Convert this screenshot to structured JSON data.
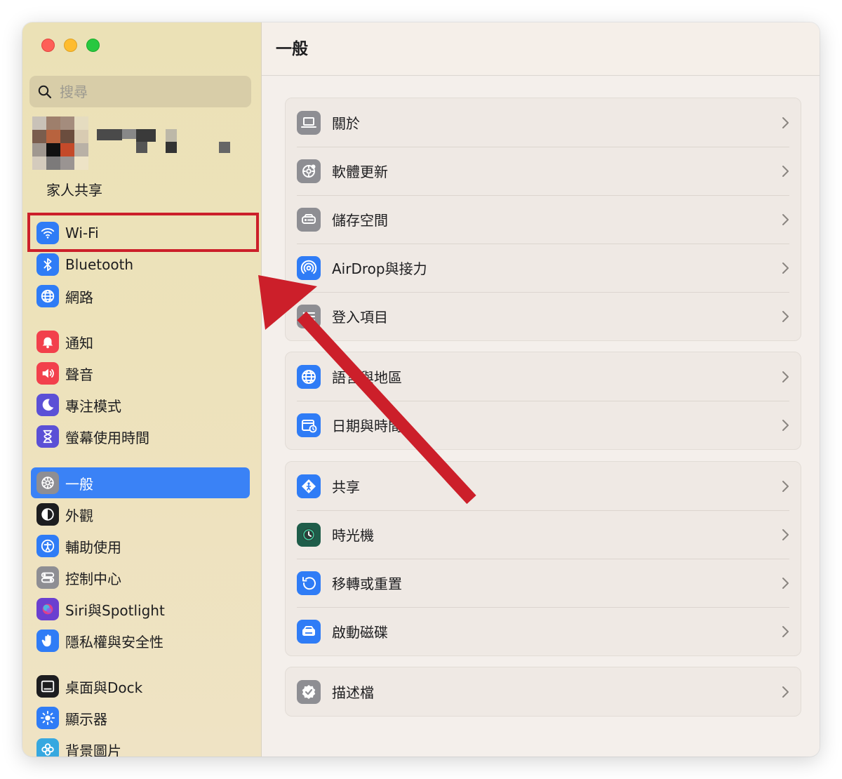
{
  "window": {
    "traffic_lights": [
      "close",
      "minimize",
      "zoom"
    ]
  },
  "sidebar": {
    "search_placeholder": "搜尋",
    "family_sharing": "家人共享",
    "items": [
      {
        "id": "wifi",
        "label": "Wi-Fi",
        "icon": "wifi-icon",
        "color": "#2f7cf6"
      },
      {
        "id": "bluetooth",
        "label": "Bluetooth",
        "icon": "bluetooth-icon",
        "color": "#2f7cf6"
      },
      {
        "id": "network",
        "label": "網路",
        "icon": "globe-icon",
        "color": "#2f7cf6"
      },
      {
        "id": "notifications",
        "label": "通知",
        "icon": "bell-icon",
        "color": "#f2404c"
      },
      {
        "id": "sound",
        "label": "聲音",
        "icon": "speaker-icon",
        "color": "#f2404c"
      },
      {
        "id": "focus",
        "label": "專注模式",
        "icon": "moon-icon",
        "color": "#5b50d6"
      },
      {
        "id": "screen-time",
        "label": "螢幕使用時間",
        "icon": "hourglass-icon",
        "color": "#5b50d6"
      },
      {
        "id": "general",
        "label": "一般",
        "icon": "gear-icon",
        "color": "#8e8e93",
        "active": true
      },
      {
        "id": "appearance",
        "label": "外觀",
        "icon": "appearance-icon",
        "color": "#1d1d1f"
      },
      {
        "id": "accessibility",
        "label": "輔助使用",
        "icon": "accessibility-icon",
        "color": "#2f7cf6"
      },
      {
        "id": "control-center",
        "label": "控制中心",
        "icon": "toggles-icon",
        "color": "#8e8e93"
      },
      {
        "id": "siri",
        "label": "Siri與Spotlight",
        "icon": "siri-icon",
        "color": "#6a3fd0"
      },
      {
        "id": "privacy",
        "label": "隱私權與安全性",
        "icon": "hand-icon",
        "color": "#2f7cf6"
      },
      {
        "id": "desktop-dock",
        "label": "桌面與Dock",
        "icon": "dock-icon",
        "color": "#1d1d1f"
      },
      {
        "id": "displays",
        "label": "顯示器",
        "icon": "sun-icon",
        "color": "#2f7cf6"
      },
      {
        "id": "wallpaper",
        "label": "背景圖片",
        "icon": "flower-icon",
        "color": "#36a8e0"
      }
    ]
  },
  "main": {
    "title": "一般",
    "groups": [
      [
        {
          "id": "about",
          "label": "關於",
          "icon": "laptop-icon",
          "color": "#8e8e93"
        },
        {
          "id": "software-update",
          "label": "軟體更新",
          "icon": "gear-badge-icon",
          "color": "#8e8e93"
        },
        {
          "id": "storage",
          "label": "儲存空間",
          "icon": "drive-icon",
          "color": "#8e8e93"
        },
        {
          "id": "airdrop",
          "label": "AirDrop與接力",
          "icon": "airdrop-icon",
          "color": "#2f7cf6"
        },
        {
          "id": "login-items",
          "label": "登入項目",
          "icon": "list-icon",
          "color": "#8e8e93"
        }
      ],
      [
        {
          "id": "language-region",
          "label": "語言與地區",
          "icon": "globe-icon",
          "color": "#2f7cf6"
        },
        {
          "id": "date-time",
          "label": "日期與時間",
          "icon": "calendar-clock-icon",
          "color": "#2f7cf6"
        }
      ],
      [
        {
          "id": "sharing",
          "label": "共享",
          "icon": "sharing-icon",
          "color": "#2f7cf6"
        },
        {
          "id": "time-machine",
          "label": "時光機",
          "icon": "time-machine-icon",
          "color": "#1f5d4a"
        },
        {
          "id": "transfer-reset",
          "label": "移轉或重置",
          "icon": "reset-icon",
          "color": "#2f7cf6"
        },
        {
          "id": "startup-disk",
          "label": "啟動磁碟",
          "icon": "disk-icon",
          "color": "#2f7cf6"
        }
      ],
      [
        {
          "id": "profiles",
          "label": "描述檔",
          "icon": "checkmark-badge-icon",
          "color": "#8e8e93"
        }
      ]
    ]
  },
  "annotation": {
    "highlight_target": "wifi",
    "arrow_color": "#cc1f2a"
  }
}
